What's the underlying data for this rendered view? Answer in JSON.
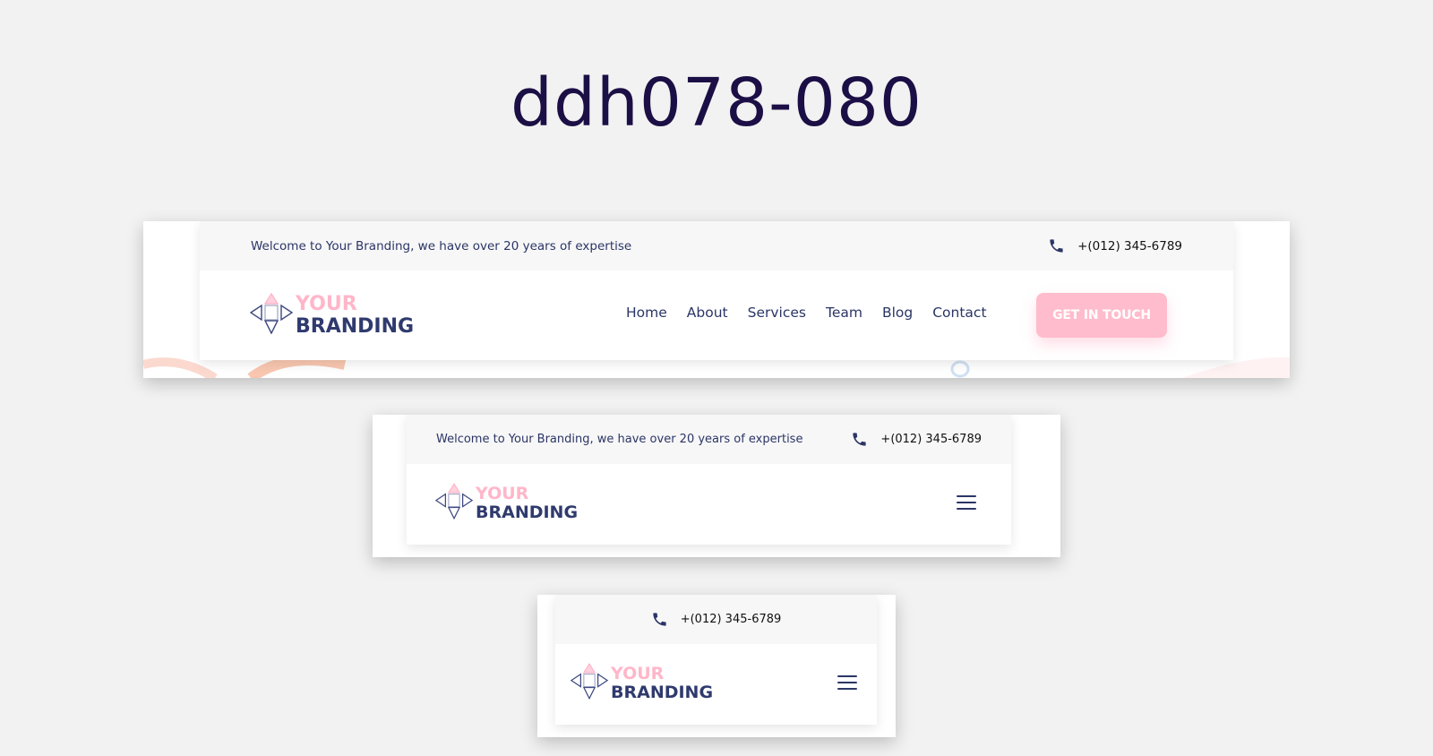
{
  "title": "ddh078-080",
  "colors": {
    "title": "#1c0f45",
    "navy": "#2b3566",
    "pink": "#ffb6c9",
    "cta_bg": "#ffbccd",
    "topbar_bg": "#f7f7f7"
  },
  "desktop": {
    "welcome": "Welcome to Your Branding, we have over 20 years of expertise",
    "phone": "+(012) 345-6789",
    "logo_your": "YOUR",
    "logo_brand": "BRANDING",
    "nav": [
      "Home",
      "About",
      "Services",
      "Team",
      "Blog",
      "Contact"
    ],
    "cta": "GET IN TOUCH"
  },
  "tablet": {
    "welcome": "Welcome to Your Branding, we have over 20 years of expertise",
    "phone": "+(012) 345-6789",
    "logo_your": "YOUR",
    "logo_brand": "BRANDING"
  },
  "mobile": {
    "phone": "+(012) 345-6789",
    "logo_your": "YOUR",
    "logo_brand": "BRANDING"
  },
  "icons": {
    "phone": "phone-icon",
    "logo": "diamond-arrows-logo-icon",
    "menu": "hamburger-menu-icon"
  }
}
